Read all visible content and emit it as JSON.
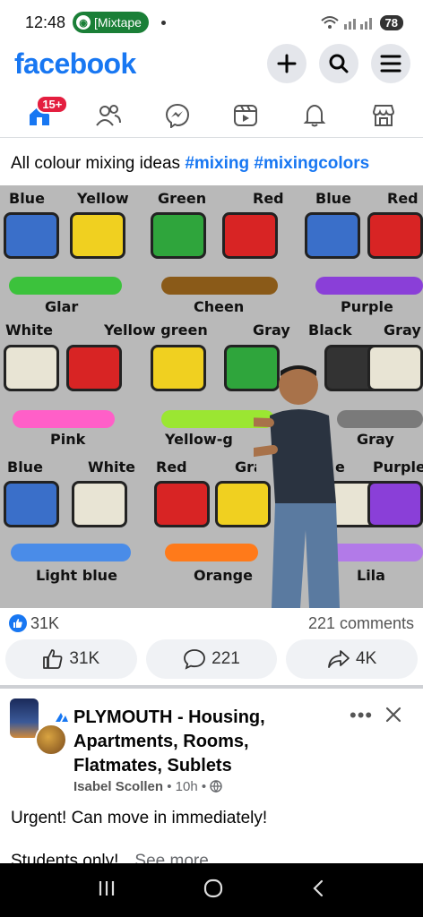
{
  "status_bar": {
    "time": "12:48",
    "notification_app": "[Mixtape",
    "battery": "78"
  },
  "header": {
    "logo": "facebook",
    "actions": [
      "plus-icon",
      "search-icon",
      "menu-icon"
    ]
  },
  "nav": {
    "notification_badge": "15+",
    "tabs": [
      "home",
      "friends",
      "messenger",
      "video",
      "notifications",
      "marketplace"
    ]
  },
  "post": {
    "caption_text": "All colour mixing ideas ",
    "hashtag1": "#mixing",
    "hashtag2": "#mixingcolors",
    "image_labels": {
      "row1": [
        "Blue",
        "Yellow",
        "Green",
        "Red",
        "Blue",
        "Red"
      ],
      "row1_results": [
        "Glar",
        "Cheen",
        "Purple"
      ],
      "row2": [
        "White",
        "Yellow green",
        "Gray",
        "Black",
        "Gray"
      ],
      "row2_results": [
        "Pink",
        "Yellow-g",
        "Gray"
      ],
      "row3": [
        "Blue",
        "White",
        "Red",
        "Gray",
        "e",
        "Purple"
      ],
      "row3_results": [
        "Light blue",
        "Orange",
        "Lila"
      ]
    },
    "reactions_count": "31K",
    "comments_count": "221 comments",
    "like_count": "31K",
    "comment_count": "221",
    "share_count": "4K",
    "colors": {
      "accent": "#1877f2"
    }
  },
  "group_post": {
    "title": "PLYMOUTH - Housing, Apartments, Rooms, Flatmates, Sublets",
    "author": "Isabel Scollen",
    "time": "10h",
    "separator": "•",
    "text_line1": "Urgent! Can move in immediately!",
    "text_line2": "Students only!",
    "see_more": "See more"
  }
}
